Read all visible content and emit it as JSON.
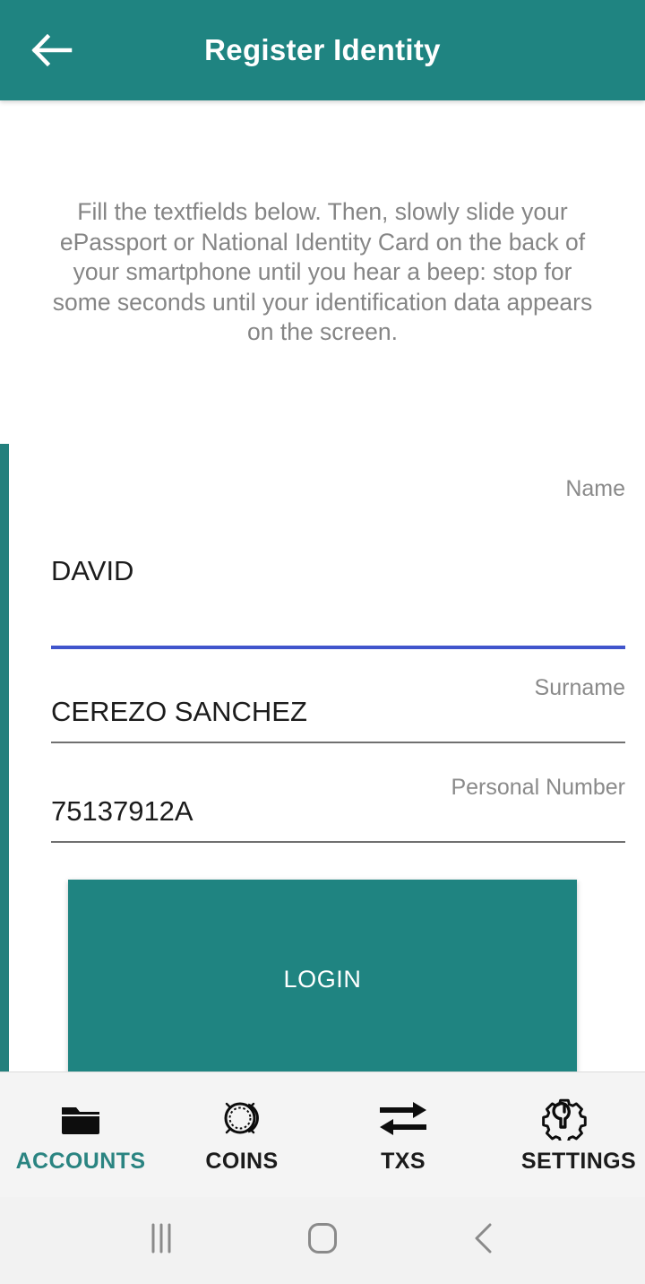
{
  "appbar": {
    "title": "Register Identity",
    "back_icon": "arrow-left-icon"
  },
  "content": {
    "instructions": "Fill the textfields below. Then, slowly slide your ePassport or National Identity Card on the back of your smartphone until you hear a beep: stop for some seconds until your identification data appears on the screen."
  },
  "form": {
    "fields": [
      {
        "label": "Name",
        "value": "DAVID",
        "focused": true
      },
      {
        "label": "Surname",
        "value": "CEREZO SANCHEZ",
        "focused": false
      },
      {
        "label": "Personal Number",
        "value": "75137912A",
        "focused": false
      }
    ],
    "submit_label": "LOGIN"
  },
  "tabbar": {
    "tabs": [
      {
        "label": "ACCOUNTS",
        "icon": "folder-icon",
        "active": true
      },
      {
        "label": "COINS",
        "icon": "coin-icon",
        "active": false
      },
      {
        "label": "TXS",
        "icon": "transfer-arrows-icon",
        "active": false
      },
      {
        "label": "SETTINGS",
        "icon": "gear-wrench-icon",
        "active": false
      }
    ]
  },
  "sysnav": {
    "recents_icon": "recents-bars-icon",
    "home_icon": "home-square-icon",
    "back_icon": "chevron-left-icon"
  },
  "colors": {
    "brand_teal": "#1F8481",
    "accent_blue": "#4055CC",
    "underline_gray": "#707070",
    "label_gray": "#8a8a8a",
    "tabbar_bg": "#f4f4f4"
  }
}
